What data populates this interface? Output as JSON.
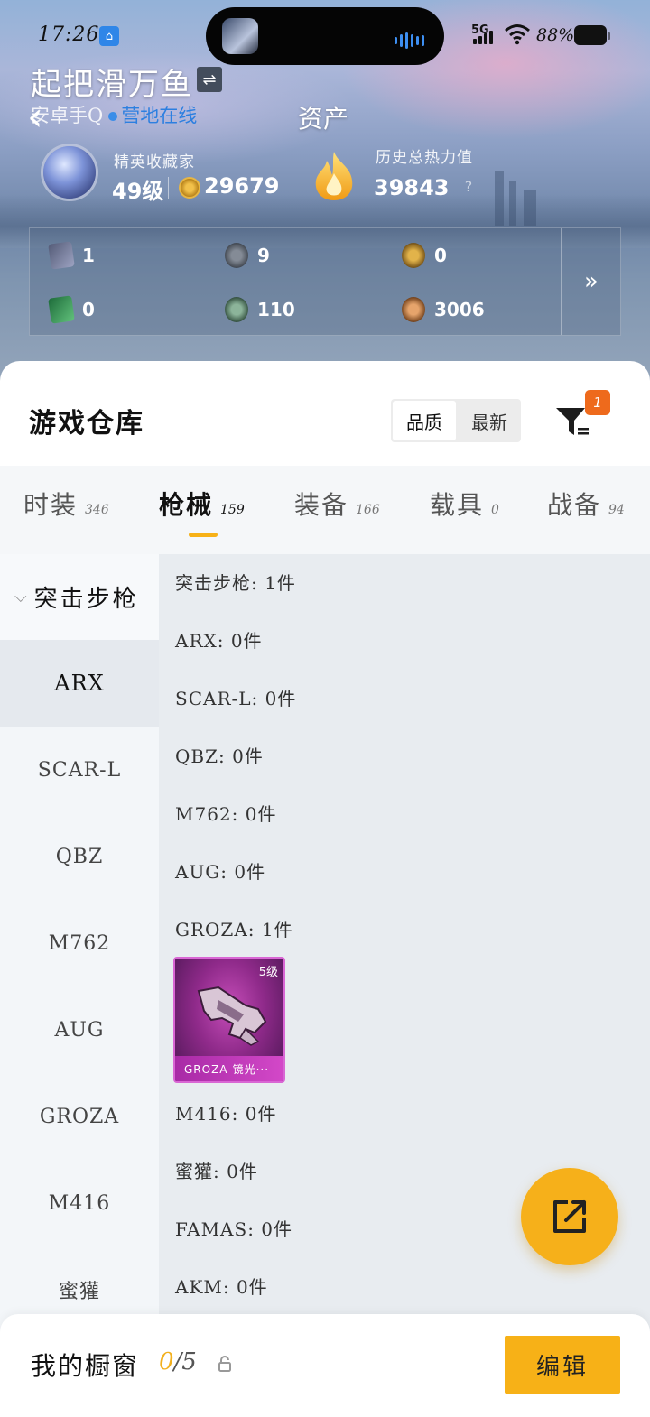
{
  "status_bar": {
    "time": "17:26",
    "network": "5G",
    "battery": "88%"
  },
  "header": {
    "player_name": "起把滑万鱼",
    "server": "安卓手Q",
    "online_status": "营地在线",
    "page_title": "资产"
  },
  "profile": {
    "rank_title": "精英收藏家",
    "rank_level": "49级",
    "coins": "29679",
    "heat_title": "历史总热力值",
    "heat_value": "39843",
    "help": "?"
  },
  "currencies": [
    {
      "icon": "silver-card-icon",
      "value": "1"
    },
    {
      "icon": "grey-coin-icon",
      "value": "9"
    },
    {
      "icon": "gold-coin-icon",
      "value": "0"
    },
    {
      "icon": "green-card-icon",
      "value": "0"
    },
    {
      "icon": "green-coin-icon",
      "value": "110"
    },
    {
      "icon": "bronze-coin-icon",
      "value": "3006"
    }
  ],
  "warehouse": {
    "title": "游戏仓库",
    "sort_options": [
      "品质",
      "最新"
    ],
    "active_sort": "品质",
    "filter_badge": "1"
  },
  "tabs": [
    {
      "label": "时装",
      "count": "346"
    },
    {
      "label": "枪械",
      "count": "159",
      "active": true
    },
    {
      "label": "装备",
      "count": "166"
    },
    {
      "label": "载具",
      "count": "0"
    },
    {
      "label": "战备",
      "count": "94"
    }
  ],
  "categories": {
    "header": "突击步枪",
    "items": [
      "ARX",
      "SCAR-L",
      "QBZ",
      "M762",
      "AUG",
      "GROZA",
      "M416",
      "蜜獾"
    ],
    "active": "ARX"
  },
  "content_rows": [
    "突击步枪: 1件",
    "ARX: 0件",
    "SCAR-L: 0件",
    "QBZ: 0件",
    "M762: 0件",
    "AUG: 0件",
    "GROZA: 1件",
    "M416: 0件",
    "蜜獾: 0件",
    "FAMAS: 0件",
    "AKM: 0件"
  ],
  "item_card": {
    "level": "5级",
    "name": "GROZA-镜光···"
  },
  "bottom_bar": {
    "showcase_label": "我的橱窗",
    "used": "0",
    "total": "/5",
    "edit_label": "编辑"
  },
  "colors": {
    "accent": "#f7b117",
    "badge": "#ee6a1c",
    "online": "#2c7fe0",
    "legendary": "#c54db8"
  }
}
